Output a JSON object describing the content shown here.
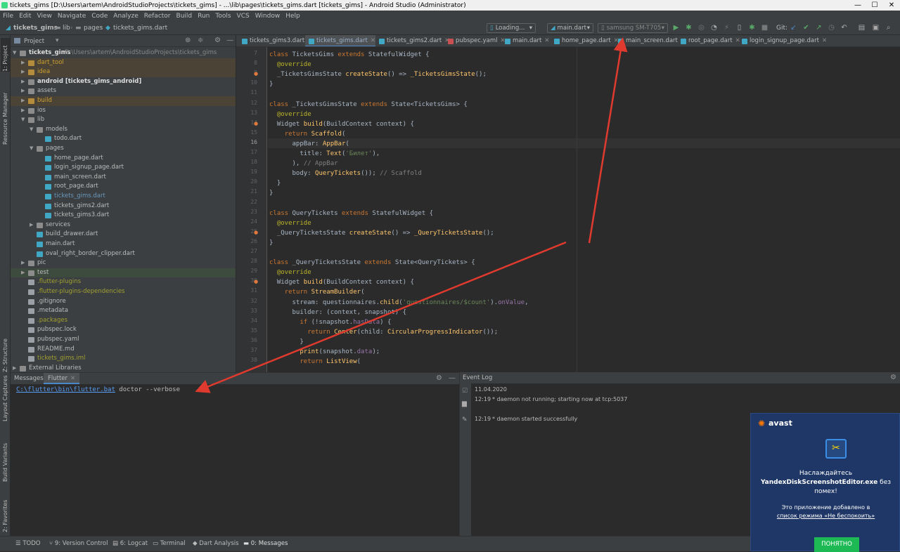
{
  "window": {
    "title": "tickets_gims [D:\\Users\\artem\\AndroidStudioProjects\\tickets_gims] - ...\\lib\\pages\\tickets_gims.dart [tickets_gims] - Android Studio (Administrator)",
    "min": "—",
    "max": "☐",
    "close": "✕"
  },
  "menu": [
    "File",
    "Edit",
    "View",
    "Navigate",
    "Code",
    "Analyze",
    "Refactor",
    "Build",
    "Run",
    "Tools",
    "VCS",
    "Window",
    "Help"
  ],
  "breadcrumb": {
    "project": "tickets_gims",
    "lib": "lib",
    "pages": "pages",
    "file": "tickets_gims.dart"
  },
  "toolbar": {
    "loading": "Loading...",
    "run_config": "main.dart",
    "device": "samsung SM-T705",
    "git": "Git:"
  },
  "project_panel": {
    "title": "Project",
    "root_name": "tickets_gims",
    "root_path": "D:\\Users\\artem\\AndroidStudioProjects\\tickets_gims",
    "items": [
      {
        "label": "dart_tool",
        "color": "#d0a030"
      },
      {
        "label": "idea",
        "color": "#d0a030"
      },
      {
        "label": "android [tickets_gims_android]",
        "color": "#dddddd"
      },
      {
        "label": "assets",
        "color": "#bbbbbb"
      },
      {
        "label": "build",
        "color": "#d0a030"
      },
      {
        "label": "ios",
        "color": "#bbbbbb"
      },
      {
        "label": "lib",
        "color": "#bbbbbb"
      },
      {
        "label": "models",
        "color": "#bbbbbb"
      },
      {
        "label": "todo.dart",
        "color": "#bbbbbb"
      },
      {
        "label": "pages",
        "color": "#bbbbbb"
      },
      {
        "label": "home_page.dart",
        "color": "#bbbbbb"
      },
      {
        "label": "login_signup_page.dart",
        "color": "#bbbbbb"
      },
      {
        "label": "main_screen.dart",
        "color": "#bbbbbb"
      },
      {
        "label": "root_page.dart",
        "color": "#bbbbbb"
      },
      {
        "label": "tickets_gims.dart",
        "color": "#6897bb"
      },
      {
        "label": "tickets_gims2.dart",
        "color": "#bbbbbb"
      },
      {
        "label": "tickets_gims3.dart",
        "color": "#bbbbbb"
      },
      {
        "label": "services",
        "color": "#bbbbbb"
      },
      {
        "label": "build_drawer.dart",
        "color": "#bbbbbb"
      },
      {
        "label": "main.dart",
        "color": "#bbbbbb"
      },
      {
        "label": "oval_right_border_clipper.dart",
        "color": "#bbbbbb"
      },
      {
        "label": "pic",
        "color": "#bbbbbb"
      },
      {
        "label": "test",
        "color": "#bbbbbb"
      },
      {
        "label": ".flutter-plugins",
        "color": "#a0a030"
      },
      {
        "label": ".flutter-plugins-dependencies",
        "color": "#a0a030"
      },
      {
        "label": ".gitignore",
        "color": "#bbbbbb"
      },
      {
        "label": ".metadata",
        "color": "#bbbbbb"
      },
      {
        "label": ".packages",
        "color": "#a0a030"
      },
      {
        "label": "pubspec.lock",
        "color": "#bbbbbb"
      },
      {
        "label": "pubspec.yaml",
        "color": "#bbbbbb"
      },
      {
        "label": "README.md",
        "color": "#bbbbbb"
      },
      {
        "label": "tickets_gims.iml",
        "color": "#a0a030"
      },
      {
        "label": "External Libraries",
        "color": "#bbbbbb"
      }
    ]
  },
  "side_tabs": {
    "project": "1: Project",
    "resource": "Resource Manager",
    "structure": "Z: Structure",
    "layout": "Layout Captures",
    "variants": "Build Variants",
    "favorites": "2: Favorites"
  },
  "editor_tabs": [
    "tickets_gims3.dart",
    "tickets_gims.dart",
    "tickets_gims2.dart",
    "pubspec.yaml",
    "main.dart",
    "home_page.dart",
    "main_screen.dart",
    "root_page.dart",
    "login_signup_page.dart"
  ],
  "line_numbers": [
    "7",
    "8",
    "9",
    "10",
    "11",
    "12",
    "13",
    "14",
    "15",
    "16",
    "17",
    "18",
    "19",
    "20",
    "21",
    "22",
    "23",
    "24",
    "25",
    "26",
    "27",
    "28",
    "29",
    "30",
    "31",
    "32",
    "33",
    "34",
    "35",
    "36",
    "37",
    "38"
  ],
  "messages": {
    "tab_messages": "Messages:",
    "tab_flutter": "Flutter",
    "cmd_link": "C:\\flutter\\bin\\flutter.bat",
    "cmd_args": " doctor --verbose"
  },
  "event_log": {
    "title": "Event Log",
    "date": "11.04.2020",
    "e1_time": "12:19",
    "e1_text": "* daemon not running; starting now at tcp:5037",
    "e2_time": "12:19",
    "e2_text": "* daemon started successfully"
  },
  "bottom_tabs": [
    "TODO",
    "9: Version Control",
    "6: Logcat",
    "Terminal",
    "Dart Analysis",
    "0: Messages"
  ],
  "avast": {
    "brand": "avast",
    "line1": "Наслаждайтесь",
    "app": "YandexDiskScreenshotEditor.exe",
    "line2": "без помех!",
    "line3": "Это приложение добавлено в",
    "link": "список режима «Не беспокоить»",
    "button": "ПОНЯТНО"
  }
}
